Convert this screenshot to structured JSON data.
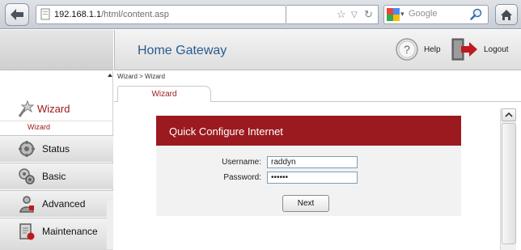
{
  "browser": {
    "url_host": "192.168.1.1",
    "url_path": "/html/content.asp",
    "search_placeholder": "Google"
  },
  "header": {
    "title": "Home Gateway",
    "help_label": "Help",
    "logout_label": "Logout"
  },
  "breadcrumb": "Wizard > Wizard",
  "tabs": [
    {
      "label": "Wizard"
    }
  ],
  "sidebar": {
    "items": [
      {
        "label": "Wizard",
        "icon": "wizard-icon",
        "active": true
      },
      {
        "label": "Status",
        "icon": "status-icon"
      },
      {
        "label": "Basic",
        "icon": "basic-icon"
      },
      {
        "label": "Advanced",
        "icon": "advanced-icon"
      },
      {
        "label": "Maintenance",
        "icon": "maintenance-icon"
      }
    ],
    "sub_items": [
      {
        "label": "Wizard"
      }
    ]
  },
  "panel": {
    "title": "Quick Configure Internet",
    "username_label": "Username:",
    "username_value": "raddyn",
    "password_label": "Password:",
    "password_value": "raddyn",
    "next_label": "Next"
  },
  "colors": {
    "accent_red": "#9a1a1f",
    "title_blue": "#2b5a92"
  }
}
